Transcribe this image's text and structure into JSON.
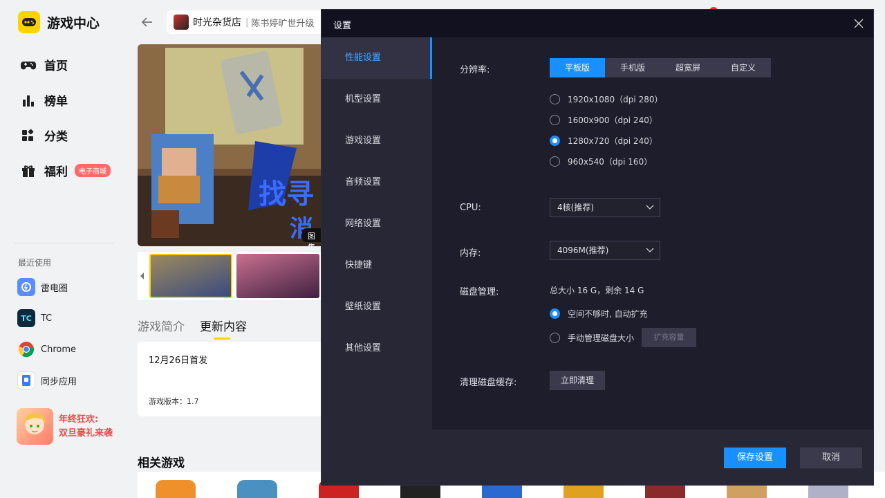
{
  "app": {
    "title": "游戏中心"
  },
  "nav": [
    {
      "label": "首页"
    },
    {
      "label": "榜单"
    },
    {
      "label": "分类"
    },
    {
      "label": "福利",
      "badge": "电子商城"
    }
  ],
  "recent": {
    "title": "最近使用",
    "items": [
      {
        "label": "雷电圈",
        "icon": "雷",
        "color": "#5a8dff"
      },
      {
        "label": "TC",
        "icon": "TC",
        "color": "#0d2a3c"
      },
      {
        "label": "Chrome",
        "icon": "",
        "color": "#ffffff"
      },
      {
        "label": "同步应用",
        "icon": "▢",
        "color": "#3a7cf0"
      }
    ]
  },
  "promo": {
    "line1": "年终狂欢:",
    "line2": "双旦豪礼来袭"
  },
  "game": {
    "name": "时光杂货店",
    "separator": "|",
    "subtitle": "陈书婷旷世升级",
    "banner_tag": "图集"
  },
  "tabs": [
    {
      "label": "游戏简介"
    },
    {
      "label": "更新内容"
    }
  ],
  "update": {
    "date": "12月26日首发",
    "version": "游戏版本：1.7"
  },
  "related": {
    "title": "相关游戏"
  },
  "dialog": {
    "title": "设置",
    "menu": [
      {
        "label": "性能设置"
      },
      {
        "label": "机型设置"
      },
      {
        "label": "游戏设置"
      },
      {
        "label": "音频设置"
      },
      {
        "label": "网络设置"
      },
      {
        "label": "快捷键"
      },
      {
        "label": "壁纸设置"
      },
      {
        "label": "其他设置"
      }
    ],
    "resolution": {
      "label": "分辨率:",
      "modes": [
        "平板版",
        "手机版",
        "超宽屏",
        "自定义"
      ],
      "selected_mode": "平板版",
      "options": [
        "1920x1080（dpi 280）",
        "1600x900（dpi 240）",
        "1280x720（dpi 240）",
        "960x540（dpi 160）"
      ],
      "selected_option": "1280x720（dpi 240）"
    },
    "cpu": {
      "label": "CPU:",
      "value": "4核(推荐)"
    },
    "memory": {
      "label": "内存:",
      "value": "4096M(推荐)"
    },
    "disk": {
      "label": "磁盘管理:",
      "info": "总大小 16 G，剩余 14 G",
      "auto": "空间不够时, 自动扩充",
      "manual": "手动管理磁盘大小",
      "expand_button": "扩充容量"
    },
    "cache": {
      "label": "清理磁盘缓存:",
      "button": "立即清理"
    },
    "save": "保存设置",
    "cancel": "取消"
  },
  "colors": {
    "accent": "#1890ff",
    "brand": "#ffd200",
    "dialog_bg": "#1d1d2b"
  }
}
